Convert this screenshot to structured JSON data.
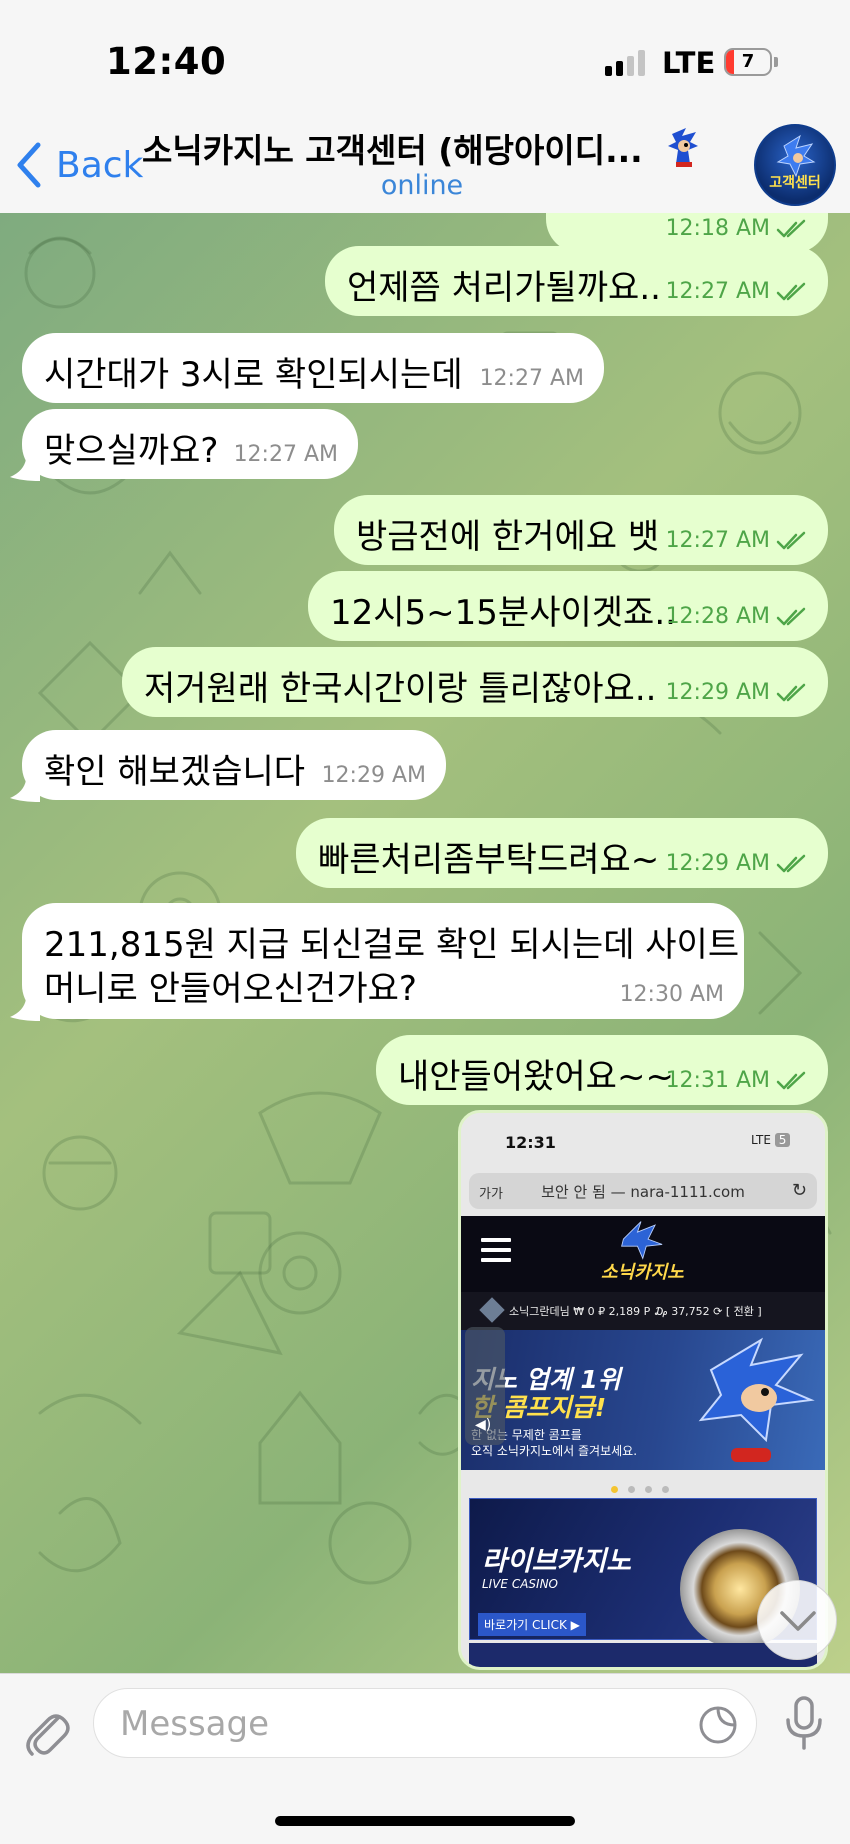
{
  "status_bar": {
    "time": "12:40",
    "network": "LTE",
    "battery_level": "7"
  },
  "header": {
    "back_label": "Back",
    "title": "소닉카지노 고객센터 (해당아이디...",
    "status": "online",
    "avatar_icon": "sonic-casino-avatar-icon",
    "avatar_text": "고객센터"
  },
  "messages": [
    {
      "dir": "out",
      "text": "언제쯤 처리가될까요..",
      "time": "12:27 AM",
      "read": true
    },
    {
      "dir": "in",
      "text": "시간대가 3시로 확인되시는데",
      "time": "12:27 AM"
    },
    {
      "dir": "in",
      "text": "맞으실까요?",
      "time": "12:27 AM"
    },
    {
      "dir": "out",
      "text": "방금전에 한거에요 뱃",
      "time": "12:27 AM",
      "read": true
    },
    {
      "dir": "out",
      "text": "12시5~15분사이겟죠..",
      "time": "12:28 AM",
      "read": true
    },
    {
      "dir": "out",
      "text": "저거원래 한국시간이랑 틀리잖아요..",
      "time": "12:29 AM",
      "read": true
    },
    {
      "dir": "in",
      "text": "확인 해보겠습니다",
      "time": "12:29 AM"
    },
    {
      "dir": "out",
      "text": "빠른처리좀부탁드려요~",
      "time": "12:29 AM",
      "read": true
    },
    {
      "dir": "in",
      "text": "211,815원 지급 되신걸로 확인 되시는데 사이트",
      "text2": "머니로 안들어오신건가요?",
      "time": "12:30 AM"
    },
    {
      "dir": "out",
      "text": "내안들어왔어요~~",
      "time": "12:31 AM",
      "read": true
    }
  ],
  "partial_top_message": {
    "time": "12:18 AM"
  },
  "screenshot_message": {
    "time": "12:31",
    "network": "LTE",
    "network_badge": "5",
    "aa": "가가",
    "address": "보안 안 됨 — nara-1111.com",
    "logo": "소닉카지노",
    "user_info": "소닉그란데님  ₩ 0   ₽ 2,189 P   ₯ 37,752  ⟳ [ 전환 ]",
    "banner_line1": "지노 업계 1위",
    "banner_line2": "한 콤프지급!",
    "banner_line3": "한 없는 무제한 콤프를",
    "banner_line4": "오직 소닉카지노에서 즐겨보세요.",
    "live_title": "라이브카지노",
    "live_sub": "LIVE CASINO",
    "live_btn": "바로가기 CLICK ▶"
  },
  "input": {
    "placeholder": "Message",
    "value": ""
  },
  "colors": {
    "accent": "#2f80ed",
    "outgoing_bubble": "#e6ffcf",
    "incoming_bubble": "#ffffff",
    "outgoing_meta": "#4ea548"
  }
}
